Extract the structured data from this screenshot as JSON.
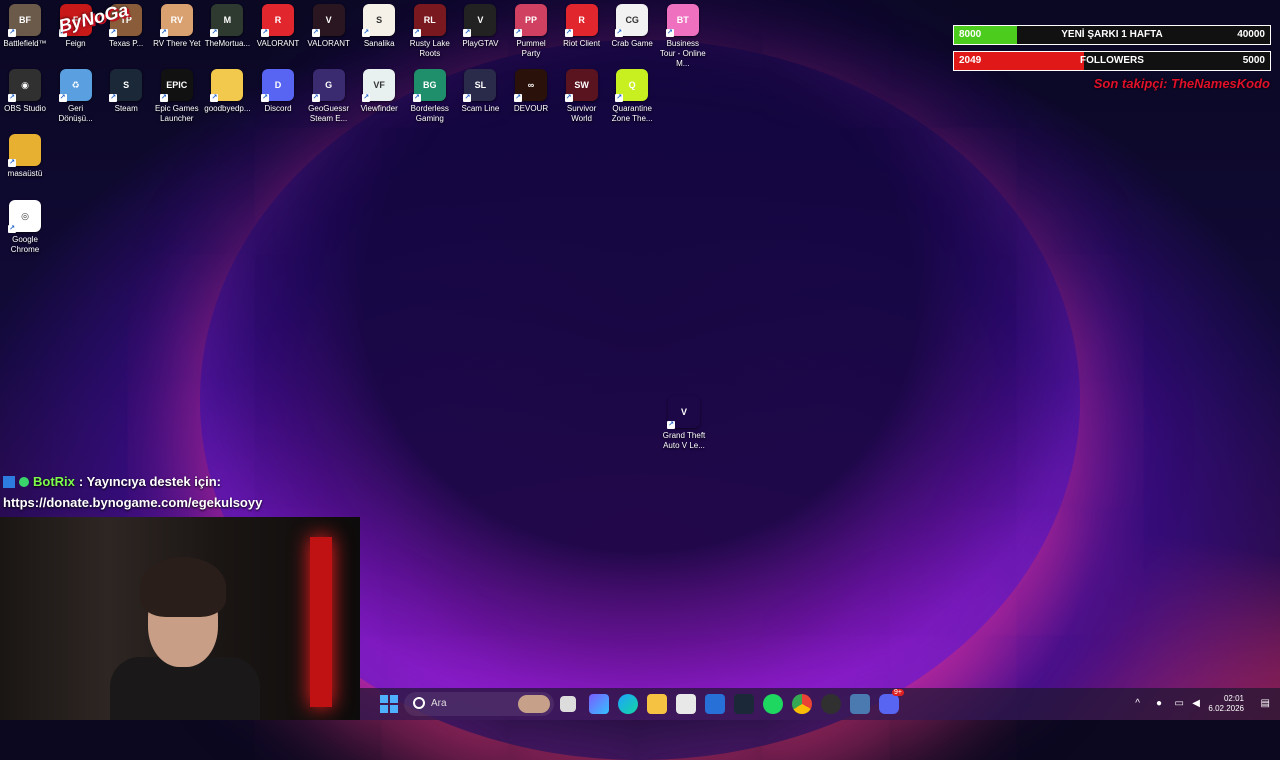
{
  "desktop": {
    "icons": [
      {
        "label": "Battlefield™",
        "bg": "#6b5a4a",
        "glyph": "BF"
      },
      {
        "label": "Feign",
        "bg": "#c81818",
        "glyph": "F"
      },
      {
        "label": "Texas P...",
        "bg": "#8a5c3a",
        "glyph": "TP"
      },
      {
        "label": "RV There Yet",
        "bg": "#d9a070",
        "glyph": "RV"
      },
      {
        "label": "TheMortua...",
        "bg": "#2e3a30",
        "glyph": "M"
      },
      {
        "label": "VALORANT",
        "bg": "#e2262e",
        "glyph": "R"
      },
      {
        "label": "VALORANT",
        "bg": "#2a1620",
        "glyph": "V"
      },
      {
        "label": "Sanalika",
        "bg": "#f5f0e8",
        "glyph": "S"
      },
      {
        "label": "Rusty Lake Roots",
        "bg": "#7a1820",
        "glyph": "RL"
      },
      {
        "label": "PlayGTAV",
        "bg": "#222",
        "glyph": "V"
      },
      {
        "label": "Pummel Party",
        "bg": "#d04060",
        "glyph": "PP"
      },
      {
        "label": "Riot Client",
        "bg": "#e2262e",
        "glyph": "R"
      },
      {
        "label": "Crab Game",
        "bg": "#f2f2f2",
        "glyph": "CG"
      },
      {
        "label": "Business Tour - Online M...",
        "bg": "#f070c0",
        "glyph": "BT"
      },
      {
        "label": "OBS Studio",
        "bg": "#303030",
        "glyph": "◉"
      },
      {
        "label": "Geri Dönüşü...",
        "bg": "#5aa0e0",
        "glyph": "♻"
      },
      {
        "label": "Steam",
        "bg": "#1b2838",
        "glyph": "S"
      },
      {
        "label": "Epic Games Launcher",
        "bg": "#111",
        "glyph": "EPIC"
      },
      {
        "label": "goodbyedp...",
        "bg": "#f2c94c",
        "glyph": ""
      },
      {
        "label": "Discord",
        "bg": "#5865f2",
        "glyph": "D"
      },
      {
        "label": "GeoGuessr Steam E...",
        "bg": "#3a2a70",
        "glyph": "G"
      },
      {
        "label": "Viewfinder",
        "bg": "#e8f0f0",
        "glyph": "VF"
      },
      {
        "label": "Borderless Gaming",
        "bg": "#1e8f6a",
        "glyph": "BG"
      },
      {
        "label": "Scam Line",
        "bg": "#2a2a4a",
        "glyph": "SL"
      },
      {
        "label": "DEVOUR",
        "bg": "#2a120a",
        "glyph": "∞"
      },
      {
        "label": "Survivor World",
        "bg": "#5a1420",
        "glyph": "SW"
      },
      {
        "label": "Quarantine Zone The...",
        "bg": "#c8f020",
        "glyph": "Q"
      },
      {
        "label": "masaüstü",
        "bg": "#e8b030",
        "glyph": ""
      },
      {
        "label": "Google Chrome",
        "bg": "#ffffff",
        "glyph": "◎"
      },
      {
        "label": "Grand Theft Auto V Le...",
        "bg": "rgba(0,0,0,0)",
        "glyph": "V"
      }
    ]
  },
  "overlay": {
    "logo_text": "ByNoGa",
    "goal_bar": {
      "left_value": "8000",
      "title": "YENİ ŞARKI 1 HAFTA",
      "right_value": "40000",
      "fill_fraction": 0.2,
      "fill_color": "#4ccc1c"
    },
    "followers_bar": {
      "left_value": "2049",
      "title": "FOLLOWERS",
      "right_value": "5000",
      "fill_fraction": 0.41,
      "fill_color": "#e01818"
    },
    "last_follower": "Son takipçi: TheNamesKodo"
  },
  "chat": {
    "username": "BotRix",
    "message": ": Yayıncıya destek için:",
    "link": "https://donate.bynogame.com/egekulsoyy"
  },
  "taskbar": {
    "search_placeholder": "Ara",
    "time": "02:01",
    "date": "6.02.2026",
    "discord_badge": "9+"
  }
}
